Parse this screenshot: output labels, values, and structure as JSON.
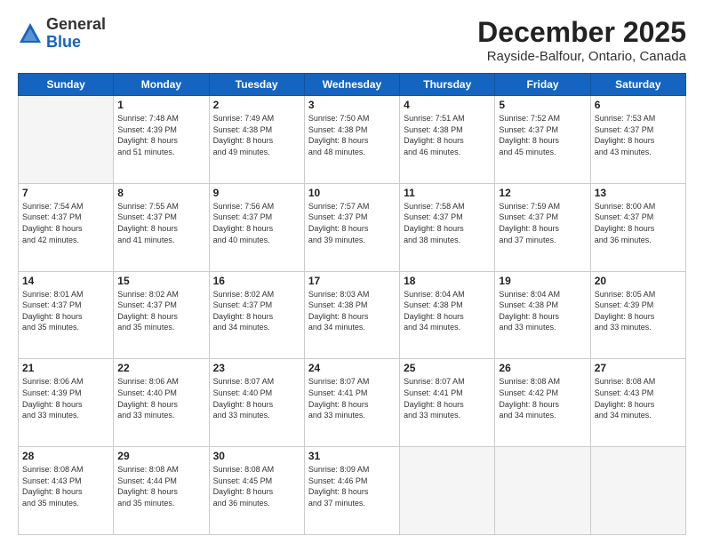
{
  "header": {
    "logo_general": "General",
    "logo_blue": "Blue",
    "month_title": "December 2025",
    "location": "Rayside-Balfour, Ontario, Canada"
  },
  "days_of_week": [
    "Sunday",
    "Monday",
    "Tuesday",
    "Wednesday",
    "Thursday",
    "Friday",
    "Saturday"
  ],
  "weeks": [
    [
      {
        "day": "",
        "info": ""
      },
      {
        "day": "1",
        "info": "Sunrise: 7:48 AM\nSunset: 4:39 PM\nDaylight: 8 hours\nand 51 minutes."
      },
      {
        "day": "2",
        "info": "Sunrise: 7:49 AM\nSunset: 4:38 PM\nDaylight: 8 hours\nand 49 minutes."
      },
      {
        "day": "3",
        "info": "Sunrise: 7:50 AM\nSunset: 4:38 PM\nDaylight: 8 hours\nand 48 minutes."
      },
      {
        "day": "4",
        "info": "Sunrise: 7:51 AM\nSunset: 4:38 PM\nDaylight: 8 hours\nand 46 minutes."
      },
      {
        "day": "5",
        "info": "Sunrise: 7:52 AM\nSunset: 4:37 PM\nDaylight: 8 hours\nand 45 minutes."
      },
      {
        "day": "6",
        "info": "Sunrise: 7:53 AM\nSunset: 4:37 PM\nDaylight: 8 hours\nand 43 minutes."
      }
    ],
    [
      {
        "day": "7",
        "info": "Sunrise: 7:54 AM\nSunset: 4:37 PM\nDaylight: 8 hours\nand 42 minutes."
      },
      {
        "day": "8",
        "info": "Sunrise: 7:55 AM\nSunset: 4:37 PM\nDaylight: 8 hours\nand 41 minutes."
      },
      {
        "day": "9",
        "info": "Sunrise: 7:56 AM\nSunset: 4:37 PM\nDaylight: 8 hours\nand 40 minutes."
      },
      {
        "day": "10",
        "info": "Sunrise: 7:57 AM\nSunset: 4:37 PM\nDaylight: 8 hours\nand 39 minutes."
      },
      {
        "day": "11",
        "info": "Sunrise: 7:58 AM\nSunset: 4:37 PM\nDaylight: 8 hours\nand 38 minutes."
      },
      {
        "day": "12",
        "info": "Sunrise: 7:59 AM\nSunset: 4:37 PM\nDaylight: 8 hours\nand 37 minutes."
      },
      {
        "day": "13",
        "info": "Sunrise: 8:00 AM\nSunset: 4:37 PM\nDaylight: 8 hours\nand 36 minutes."
      }
    ],
    [
      {
        "day": "14",
        "info": "Sunrise: 8:01 AM\nSunset: 4:37 PM\nDaylight: 8 hours\nand 35 minutes."
      },
      {
        "day": "15",
        "info": "Sunrise: 8:02 AM\nSunset: 4:37 PM\nDaylight: 8 hours\nand 35 minutes."
      },
      {
        "day": "16",
        "info": "Sunrise: 8:02 AM\nSunset: 4:37 PM\nDaylight: 8 hours\nand 34 minutes."
      },
      {
        "day": "17",
        "info": "Sunrise: 8:03 AM\nSunset: 4:38 PM\nDaylight: 8 hours\nand 34 minutes."
      },
      {
        "day": "18",
        "info": "Sunrise: 8:04 AM\nSunset: 4:38 PM\nDaylight: 8 hours\nand 34 minutes."
      },
      {
        "day": "19",
        "info": "Sunrise: 8:04 AM\nSunset: 4:38 PM\nDaylight: 8 hours\nand 33 minutes."
      },
      {
        "day": "20",
        "info": "Sunrise: 8:05 AM\nSunset: 4:39 PM\nDaylight: 8 hours\nand 33 minutes."
      }
    ],
    [
      {
        "day": "21",
        "info": "Sunrise: 8:06 AM\nSunset: 4:39 PM\nDaylight: 8 hours\nand 33 minutes."
      },
      {
        "day": "22",
        "info": "Sunrise: 8:06 AM\nSunset: 4:40 PM\nDaylight: 8 hours\nand 33 minutes."
      },
      {
        "day": "23",
        "info": "Sunrise: 8:07 AM\nSunset: 4:40 PM\nDaylight: 8 hours\nand 33 minutes."
      },
      {
        "day": "24",
        "info": "Sunrise: 8:07 AM\nSunset: 4:41 PM\nDaylight: 8 hours\nand 33 minutes."
      },
      {
        "day": "25",
        "info": "Sunrise: 8:07 AM\nSunset: 4:41 PM\nDaylight: 8 hours\nand 33 minutes."
      },
      {
        "day": "26",
        "info": "Sunrise: 8:08 AM\nSunset: 4:42 PM\nDaylight: 8 hours\nand 34 minutes."
      },
      {
        "day": "27",
        "info": "Sunrise: 8:08 AM\nSunset: 4:43 PM\nDaylight: 8 hours\nand 34 minutes."
      }
    ],
    [
      {
        "day": "28",
        "info": "Sunrise: 8:08 AM\nSunset: 4:43 PM\nDaylight: 8 hours\nand 35 minutes."
      },
      {
        "day": "29",
        "info": "Sunrise: 8:08 AM\nSunset: 4:44 PM\nDaylight: 8 hours\nand 35 minutes."
      },
      {
        "day": "30",
        "info": "Sunrise: 8:08 AM\nSunset: 4:45 PM\nDaylight: 8 hours\nand 36 minutes."
      },
      {
        "day": "31",
        "info": "Sunrise: 8:09 AM\nSunset: 4:46 PM\nDaylight: 8 hours\nand 37 minutes."
      },
      {
        "day": "",
        "info": ""
      },
      {
        "day": "",
        "info": ""
      },
      {
        "day": "",
        "info": ""
      }
    ]
  ]
}
